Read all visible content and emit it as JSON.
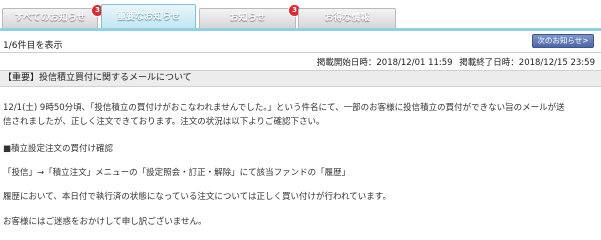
{
  "tabs": [
    {
      "label": "すべてのお知らせ",
      "badge": "3"
    },
    {
      "label": "重要なお知らせ",
      "badge": ""
    },
    {
      "label": "お知らせ",
      "badge": "3"
    },
    {
      "label": "お得な情報",
      "badge": ""
    }
  ],
  "pager": {
    "count": "1/6件目を表示",
    "next_label": "次のお知らせ>"
  },
  "dates": {
    "start": "掲載開始日時：2018/12/01 11:59",
    "end": "掲載終了日時：2018/12/15 23:59"
  },
  "notice": {
    "title": "【重要】投信積立買付に関するメールについて",
    "para1_line1": "12/1(土) 9時50分頃、「投信積立の買付けがおこなわれませんでした。」という件名にて、一部のお客様に投信積立の買付ができない旨のメールが送",
    "para1_line2": "信されましたが、正しく注文できております。注文の状況は以下よりご確認下さい。",
    "section_heading": "■積立設定注文の買付け確認",
    "menu_path": "「投信」→「積立注文」メニューの「設定照会・訂正・解除」にて該当ファンドの「履歴」",
    "history_note": "履歴において、本日付で執行済の状態になっている注文については正しく買い付けが行われています。",
    "apology": "お客様にはご迷惑をおかけして申し訳ございません。"
  },
  "colors": {
    "active_tab": "#c1e5f2",
    "badge": "#e1262d",
    "next_button": "#4c67a6",
    "tab_underline": "#8fd0e8"
  }
}
